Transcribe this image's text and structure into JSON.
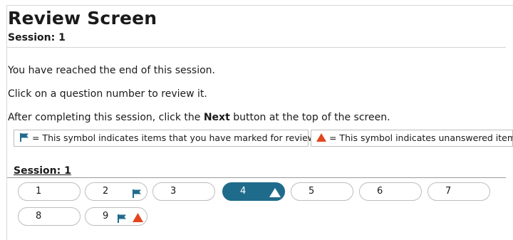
{
  "header": {
    "title": "Review Screen",
    "session_label": "Session: 1"
  },
  "instructions": {
    "line1": "You have reached the end of this session.",
    "line2": "Click on a question number to review it.",
    "line3_prefix": "After completing this session, click the ",
    "line3_bold": "Next",
    "line3_suffix": " button at the top of the screen."
  },
  "legend": {
    "flag_text": "= This symbol indicates items that you have marked for review.",
    "unanswered_text": "= This symbol indicates unanswered items."
  },
  "section": {
    "heading": "Session: 1",
    "questions": [
      {
        "label": "1",
        "flagged": false,
        "unanswered": false,
        "active": false
      },
      {
        "label": "2",
        "flagged": true,
        "unanswered": false,
        "active": false
      },
      {
        "label": "3",
        "flagged": false,
        "unanswered": false,
        "active": false
      },
      {
        "label": "4",
        "flagged": false,
        "unanswered": true,
        "active": true
      },
      {
        "label": "5",
        "flagged": false,
        "unanswered": false,
        "active": false
      },
      {
        "label": "6",
        "flagged": false,
        "unanswered": false,
        "active": false
      },
      {
        "label": "7",
        "flagged": false,
        "unanswered": false,
        "active": false
      },
      {
        "label": "8",
        "flagged": false,
        "unanswered": false,
        "active": false
      },
      {
        "label": "9",
        "flagged": true,
        "unanswered": true,
        "active": false
      }
    ]
  },
  "colors": {
    "flag": "#1f6b8c",
    "unanswered": "#e2461f",
    "active_bg": "#1f6b8c"
  }
}
